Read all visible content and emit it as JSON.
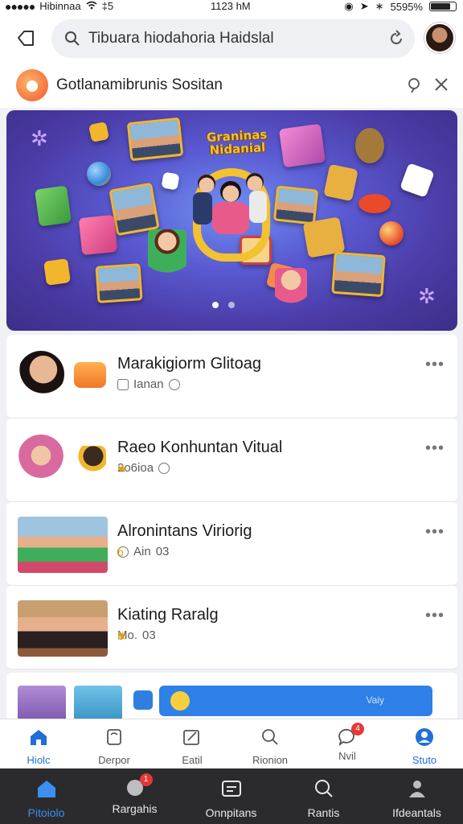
{
  "status_bar": {
    "carrier": "Hibinnaa",
    "signal_extra": "‡5",
    "time": "1123 hM",
    "battery": "5595%"
  },
  "search": {
    "value": "Tibuara hiodahoria Haidslal",
    "placeholder": "Tibuara hiodahoria Haidslal"
  },
  "notice": {
    "title": "Gotlanamibrunis Sositan"
  },
  "banner": {
    "headline": "Graninas Nidanial",
    "pages": 2,
    "active_page": 1
  },
  "list": [
    {
      "name": "Marakigiorm Glitoag",
      "meta": "Ianan",
      "more": "•••"
    },
    {
      "name": "Raeo Konhuntan Vitual",
      "meta": "2o6ioa",
      "more": "•••"
    },
    {
      "name": "Alronintans Viriorig",
      "meta": "Ain",
      "meta2": "03",
      "more": "•••"
    },
    {
      "name": "Kiating Raralg",
      "meta": "Mo.",
      "meta2": "03",
      "more": "•••"
    }
  ],
  "partial_row": {
    "bar_text": "Vaiy"
  },
  "tabbar": [
    {
      "label": "Hiolc",
      "icon": "home-icon",
      "active": true
    },
    {
      "label": "Derpor",
      "icon": "bookmark-icon",
      "active": false
    },
    {
      "label": "Eatil",
      "icon": "edit-icon",
      "active": false
    },
    {
      "label": "Rionion",
      "icon": "search-icon",
      "active": false
    },
    {
      "label": "Nvil",
      "icon": "chat-icon",
      "badge": "4",
      "active": false
    },
    {
      "label": "Stuto",
      "icon": "profile-icon",
      "active": true
    }
  ],
  "dock": [
    {
      "label": "Pitoiolo",
      "icon": "home-icon",
      "active": true
    },
    {
      "label": "Rargahis",
      "icon": "chat-icon",
      "badge": "1",
      "active": false
    },
    {
      "label": "Onnpitans",
      "icon": "document-icon",
      "active": false
    },
    {
      "label": "Rantis",
      "icon": "search-icon",
      "active": false
    },
    {
      "label": "Ifdeantals",
      "icon": "profile-icon",
      "active": false
    }
  ],
  "colors": {
    "accent": "#1f6fd6",
    "banner_top": "#6f8ff2",
    "banner_edge": "#3c2e88",
    "dock_bg": "#2b2b2e",
    "badge_red": "#e53935"
  }
}
